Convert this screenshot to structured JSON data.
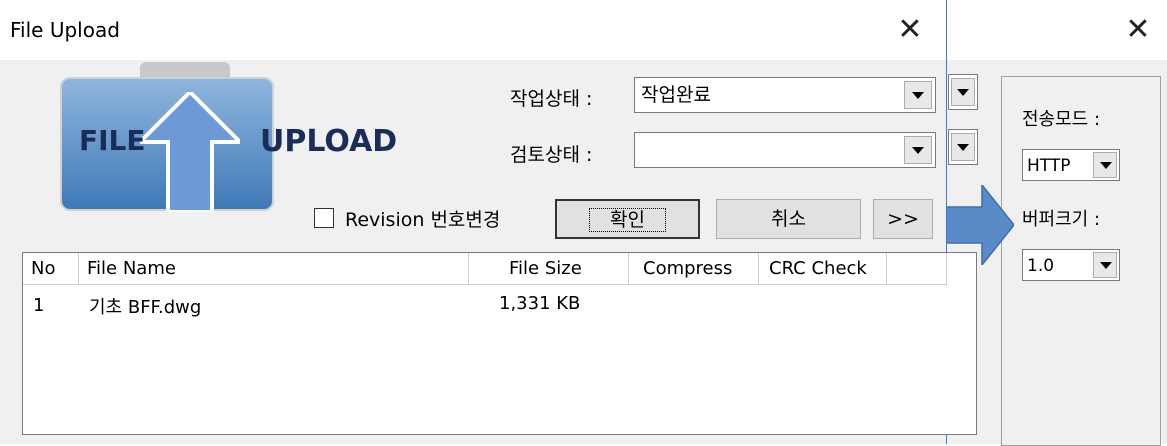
{
  "background_window": {
    "close_icon": "close-icon",
    "side_panel": {
      "transfer_mode_label": "전송모드 :",
      "transfer_mode_value": "HTTP",
      "buffer_size_label": "버퍼크기 :",
      "buffer_size_value": "1.0"
    }
  },
  "window": {
    "title": "File Upload",
    "close_icon": "close-icon"
  },
  "logo": {
    "left_text": "FILE",
    "right_text": "UPLOAD"
  },
  "form": {
    "work_status_label": "작업상태 :",
    "work_status_value": "작업완료",
    "review_status_label": "검토상태 :",
    "review_status_value": "",
    "revision_checkbox_label": "Revision 번호변경",
    "revision_checked": false
  },
  "buttons": {
    "confirm": "확인",
    "cancel": "취소",
    "expand": ">>"
  },
  "table": {
    "columns": [
      "No",
      "File Name",
      "File Size",
      "Compress",
      "CRC Check"
    ],
    "rows": [
      {
        "no": "1",
        "file_name": "기초 BFF.dwg",
        "file_size": "1,331 KB",
        "compress": "",
        "crc": ""
      }
    ]
  },
  "colors": {
    "accent": "#3a7bd5",
    "arrow": "#5b8ac8"
  }
}
